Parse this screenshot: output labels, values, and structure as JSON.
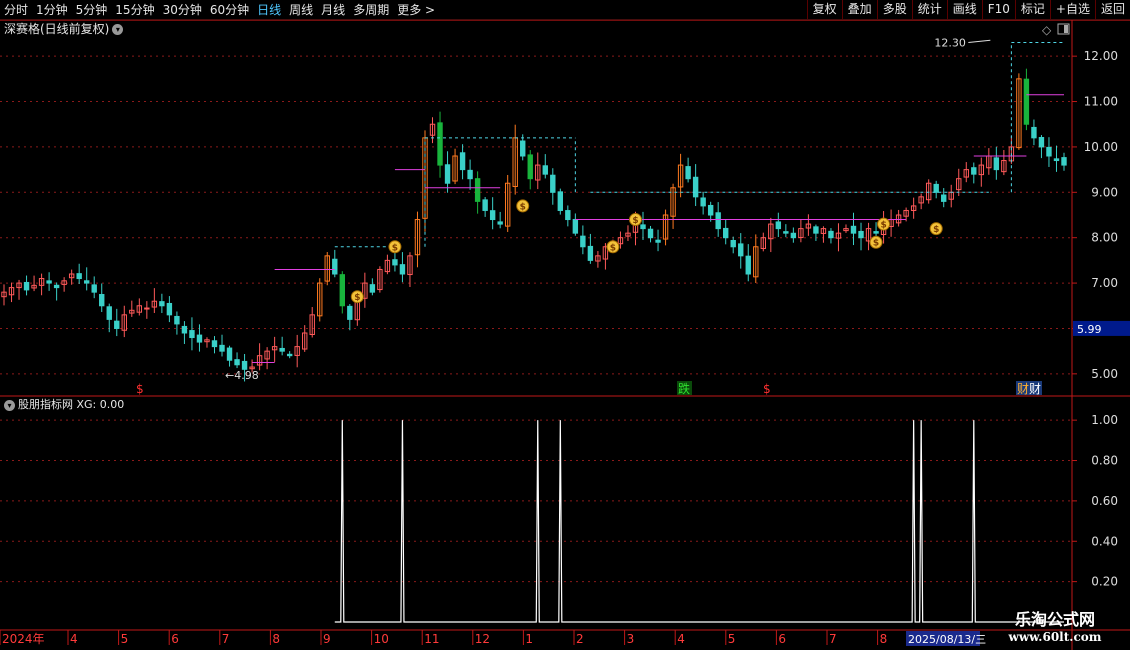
{
  "toolbar": {
    "tabs": [
      "分时",
      "1分钟",
      "5分钟",
      "15分钟",
      "30分钟",
      "60分钟",
      "日线",
      "周线",
      "月线",
      "多周期",
      "更多 >"
    ],
    "active_tab": "日线",
    "right_buttons": [
      "复权",
      "叠加",
      "多股",
      "统计",
      "画线",
      "F10",
      "标记",
      "+自选",
      "返回"
    ]
  },
  "header": {
    "title": "深赛格(日线前复权)"
  },
  "indicator": {
    "title": "股朋指标网 XG: 0.00"
  },
  "price_axis": {
    "ticks": [
      "12.00",
      "11.00",
      "10.00",
      "9.00",
      "8.00",
      "7.00",
      "6.00",
      "5.00"
    ],
    "current_price": "5.99"
  },
  "indicator_axis": {
    "ticks": [
      "1.00",
      "0.80",
      "0.60",
      "0.40",
      "0.20"
    ]
  },
  "annotations": {
    "high_label": "12.30",
    "low_label": "4.98"
  },
  "time_axis": {
    "labels": [
      "2024年",
      "4",
      "5",
      "6",
      "7",
      "8",
      "9",
      "10",
      "11",
      "12",
      "1",
      "2",
      "3",
      "4",
      "5",
      "6",
      "7",
      "8"
    ],
    "cursor_date": "2025/08/13/三"
  },
  "events": {
    "die_label": "跌",
    "cai_label": "财",
    "dollar": "$"
  },
  "colors": {
    "up": "#ff5a5a",
    "down": "#3ad0c8",
    "magenta": "#e040e0",
    "cyan": "#4fd6e6",
    "grid": "#8b1a1a",
    "axis": "#c01818"
  },
  "watermark": {
    "line1": "乐淘公式网",
    "line2": "www.60lt.com"
  },
  "chart_data": {
    "type": "candlestick",
    "price_range": [
      4.6,
      12.4
    ],
    "close_series": [
      6.8,
      6.9,
      7.0,
      6.85,
      6.95,
      7.1,
      7.0,
      6.9,
      7.05,
      7.2,
      7.1,
      7.0,
      6.8,
      6.5,
      6.2,
      6.0,
      6.3,
      6.4,
      6.5,
      6.45,
      6.6,
      6.5,
      6.3,
      6.1,
      5.9,
      5.8,
      5.7,
      5.75,
      5.6,
      5.5,
      5.3,
      5.2,
      5.1,
      5.15,
      5.4,
      5.5,
      5.6,
      5.5,
      5.4,
      5.6,
      5.9,
      6.3,
      7.0,
      7.6,
      7.2,
      6.5,
      6.2,
      6.6,
      7.0,
      6.8,
      7.3,
      7.5,
      7.4,
      7.2,
      7.6,
      8.4,
      10.2,
      10.5,
      9.6,
      9.2,
      9.8,
      9.5,
      9.3,
      8.8,
      8.6,
      8.4,
      8.3,
      9.2,
      10.2,
      9.8,
      9.3,
      9.6,
      9.4,
      9.0,
      8.6,
      8.4,
      8.1,
      7.8,
      7.5,
      7.6,
      7.8,
      7.9,
      8.0,
      8.1,
      8.3,
      8.2,
      8.0,
      7.9,
      8.5,
      9.1,
      9.6,
      9.3,
      8.9,
      8.7,
      8.5,
      8.2,
      8.0,
      7.8,
      7.6,
      7.2,
      7.8,
      8.0,
      8.3,
      8.2,
      8.1,
      8.0,
      8.2,
      8.3,
      8.1,
      8.2,
      8.0,
      8.1,
      8.2,
      8.1,
      8.0,
      8.2,
      8.1,
      8.3,
      8.4,
      8.5,
      8.6,
      8.7,
      8.9,
      9.2,
      9.0,
      8.8,
      9.0,
      9.3,
      9.5,
      9.4,
      9.6,
      9.8,
      9.5,
      9.7,
      10.0,
      11.5,
      10.5,
      10.2,
      10.0,
      9.8,
      9.7,
      9.6
    ],
    "xg_signals": [
      0,
      0,
      0,
      0,
      0,
      0,
      0,
      0,
      0,
      0,
      0,
      0,
      0,
      0,
      0,
      0,
      0,
      0,
      0,
      0,
      0,
      0,
      0,
      0,
      0,
      0,
      0,
      0,
      0,
      0,
      0,
      0,
      0,
      0,
      0,
      0,
      0,
      0,
      0,
      0,
      0,
      0,
      1,
      0,
      0,
      1,
      0,
      0,
      0,
      0,
      0,
      0,
      0,
      1,
      0,
      0,
      0,
      0,
      0,
      0,
      0,
      0,
      0,
      0,
      0,
      0,
      0,
      0,
      0,
      0,
      0,
      1,
      0,
      0,
      1,
      0,
      0,
      0,
      0,
      0,
      0,
      0,
      0,
      0,
      0,
      0,
      0,
      0,
      0,
      0,
      0,
      0,
      0,
      0,
      0,
      0,
      0,
      0,
      0,
      0,
      0,
      0,
      0,
      0,
      0,
      0,
      0,
      0,
      0,
      0,
      0,
      0,
      0,
      0,
      0,
      0,
      0,
      0,
      0,
      0,
      0,
      1,
      1,
      0,
      0,
      0,
      0,
      0,
      0,
      1,
      0,
      0,
      0,
      0,
      0,
      0,
      0,
      0,
      0,
      0,
      0,
      0,
      0,
      0,
      0,
      0
    ]
  }
}
